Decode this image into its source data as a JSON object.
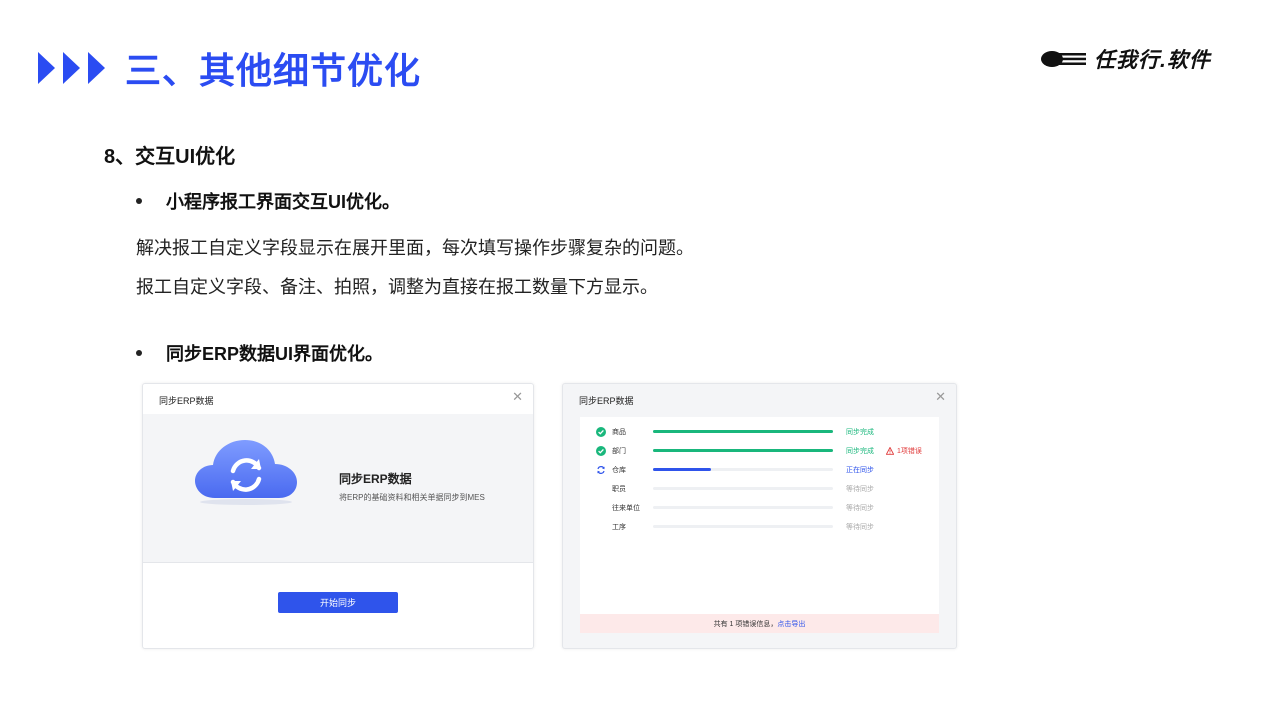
{
  "header": {
    "title": "三、其他细节优化",
    "logo_text": "任我行.软件",
    "accent_color": "#2b4cf2"
  },
  "section": {
    "heading": "8、交互UI优化",
    "bullet1": "小程序报工界面交互UI优化。",
    "para1": "解决报工自定义字段显示在展开里面，每次填写操作步骤复杂的问题。",
    "para2": "报工自定义字段、备注、拍照，调整为直接在报工数量下方显示。",
    "bullet2": "同步ERP数据UI界面优化。"
  },
  "dialog1": {
    "title": "同步ERP数据",
    "heading": "同步ERP数据",
    "description": "将ERP的基础资料和相关单据同步到MES",
    "start_button": "开始同步",
    "icon": "cloud-sync-icon"
  },
  "dialog2": {
    "title": "同步ERP数据",
    "items": [
      {
        "name": "商品",
        "status": "同步完成",
        "state": "done",
        "progress": 1.0,
        "error": ""
      },
      {
        "name": "部门",
        "status": "同步完成",
        "state": "done",
        "progress": 1.0,
        "error": "1项错误"
      },
      {
        "name": "仓库",
        "status": "正在同步",
        "state": "syncing",
        "progress": 0.32,
        "error": ""
      },
      {
        "name": "职员",
        "status": "等待同步",
        "state": "waiting",
        "progress": 0,
        "error": ""
      },
      {
        "name": "往来单位",
        "status": "等待同步",
        "state": "waiting",
        "progress": 0,
        "error": ""
      },
      {
        "name": "工序",
        "status": "等待同步",
        "state": "waiting",
        "progress": 0,
        "error": ""
      }
    ],
    "footer_text": "共有 1 项错误信息，",
    "footer_link": "点击导出",
    "colors": {
      "done": "#19b77c",
      "syncing": "#2f54eb",
      "error": "#e03a3a"
    }
  }
}
